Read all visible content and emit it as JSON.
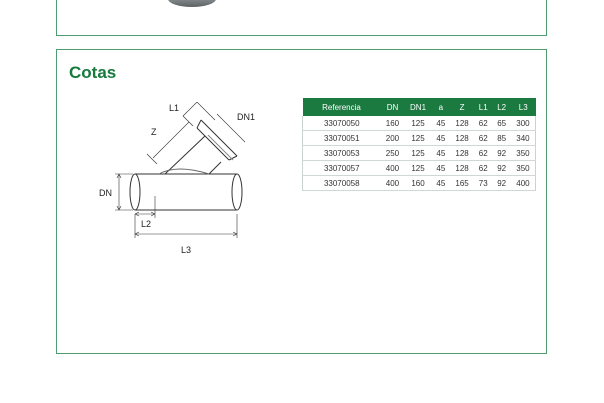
{
  "section": {
    "title": "Cotas"
  },
  "diagram": {
    "labels": [
      "L1",
      "DN1",
      "Z",
      "DN",
      "L2",
      "L3"
    ]
  },
  "table": {
    "headers": [
      "Referencia",
      "DN",
      "DN1",
      "a",
      "Z",
      "L1",
      "L2",
      "L3"
    ],
    "rows": [
      [
        "33070050",
        "160",
        "125",
        "45",
        "128",
        "62",
        "65",
        "300"
      ],
      [
        "33070051",
        "200",
        "125",
        "45",
        "128",
        "62",
        "85",
        "340"
      ],
      [
        "33070053",
        "250",
        "125",
        "45",
        "128",
        "62",
        "92",
        "350"
      ],
      [
        "33070057",
        "400",
        "125",
        "45",
        "128",
        "62",
        "92",
        "350"
      ],
      [
        "33070058",
        "400",
        "160",
        "45",
        "165",
        "73",
        "92",
        "400"
      ]
    ]
  },
  "colors": {
    "accent": "#157a3c",
    "header_bg": "#1a7a40",
    "panel_border": "#4f9a6e"
  }
}
